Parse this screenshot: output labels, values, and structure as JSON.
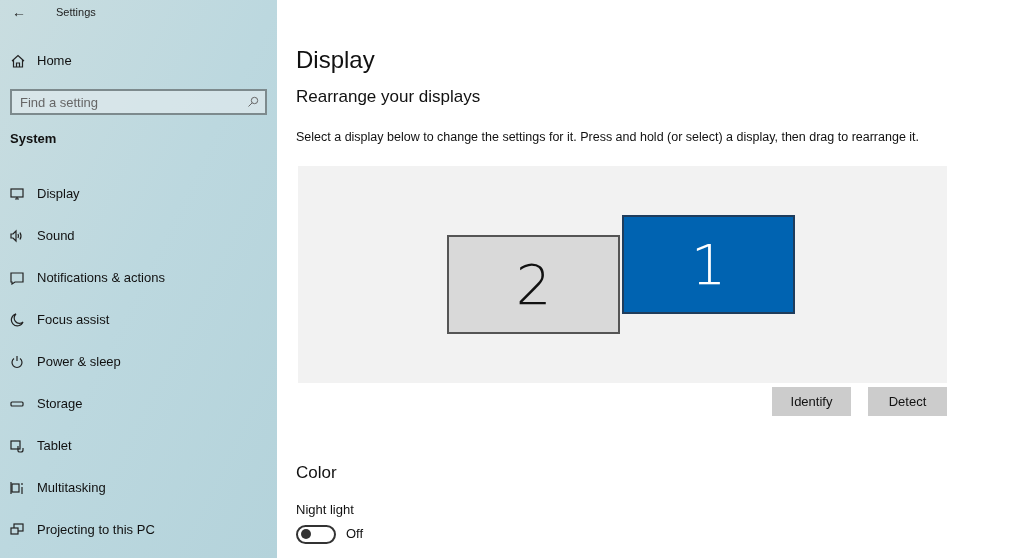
{
  "window": {
    "title": "Settings",
    "back": "←"
  },
  "sidebar": {
    "home": "Home",
    "search": {
      "placeholder": "Find a setting"
    },
    "section": "System",
    "items": [
      {
        "label": "Display"
      },
      {
        "label": "Sound"
      },
      {
        "label": "Notifications & actions"
      },
      {
        "label": "Focus assist"
      },
      {
        "label": "Power & sleep"
      },
      {
        "label": "Storage"
      },
      {
        "label": "Tablet"
      },
      {
        "label": "Multitasking"
      },
      {
        "label": "Projecting to this PC"
      }
    ]
  },
  "page": {
    "title": "Display",
    "subtitle": "Rearrange your displays",
    "description": "Select a display below to change the settings for it. Press and hold (or select) a display, then drag to rearrange it.",
    "displays": [
      {
        "number": "2",
        "selected": false
      },
      {
        "number": "1",
        "selected": true
      }
    ],
    "buttons": [
      "Identify",
      "Detect"
    ],
    "color_heading": "Color",
    "night_light": {
      "label": "Night light",
      "on": false,
      "state": "Off"
    }
  }
}
